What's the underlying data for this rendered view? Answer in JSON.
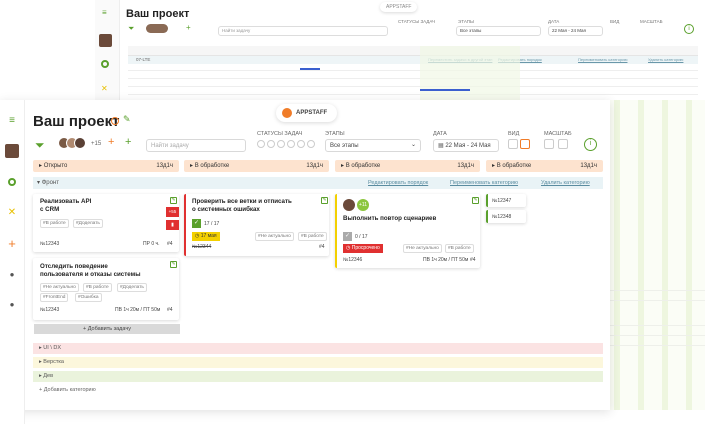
{
  "background": {
    "title": "Ваш проект",
    "brand": "APPSTAFF",
    "search_placeholder": "Найти задачу",
    "status_label": "СТАТУСЫ ЗАДАЧ",
    "stages_label": "ЭТАПЫ",
    "stages_value": "Все этапы",
    "date_label": "ДАТА",
    "date_value": "22 Мая - 24 Мая",
    "view_label": "ВИД",
    "scale_label": "МАСШТАБ",
    "rows_label": "07-LTE",
    "links": [
      "Переместить задачи в другой этап",
      "Редактировать порядок",
      "Переименовать категорию",
      "Удалить категорию"
    ]
  },
  "header": {
    "title": "Ваш проект",
    "brand": "APPSTAFF",
    "avatar_count": "+15",
    "search_placeholder": "Найти задачу",
    "status_label": "СТАТУСЫ ЗАДАЧ",
    "stages_label": "ЭТАПЫ",
    "stages_value": "Все этапы",
    "date_label": "ДАТА",
    "date_value": "22 Мая - 24 Мая",
    "view_label": "ВИД",
    "scale_label": "МАСШТАБ"
  },
  "columns": [
    {
      "label": "Открыто",
      "count": "13д1ч",
      "color": "#fde3cf"
    },
    {
      "label": "В обработке",
      "count": "13д1ч",
      "color": "#fde3cf"
    },
    {
      "label": "В обработке",
      "count": "13д1ч",
      "color": "#fde3cf"
    },
    {
      "label": "В обработке",
      "count": "13д1ч",
      "color": "#fde3cf"
    }
  ],
  "category": {
    "name": "Фронт",
    "links": [
      "Редактировать порядок",
      "Переименовать категорию",
      "Удалить категорию"
    ]
  },
  "cards": {
    "c1": {
      "title": "Реализовать API\nс CRM",
      "tags": [
        "#В работе",
        "#Доделать"
      ],
      "id": "№12343",
      "est": "ПР 0 ч.",
      "num": "#4",
      "badge": "+55"
    },
    "c2": {
      "title": "Отследить поведение\nпользователя и отказы системы",
      "tags": [
        "#Не актуально",
        "#В работе",
        "#Доделать",
        "#FrontEnd",
        "#Ошибка"
      ],
      "id": "№12343",
      "est": "ПВ 1ч 20м / ПТ 50м",
      "num": "#4"
    },
    "c3": {
      "title": "Проверить все ветки и отписать\nо системных ошибках",
      "progress": "17 / 17",
      "deadline": "17 мая",
      "tags": [
        "#Не актуально",
        "#В работе"
      ],
      "id": "№12344",
      "num": "#4"
    },
    "c4": {
      "title": "Выполнить повтор сценариев",
      "avatar_badge": "+11",
      "progress": "0 / 17",
      "overdue": "Просрочено",
      "tags": [
        "#Не актуально",
        "#В работе"
      ],
      "id": "№12346",
      "est": "ПВ 1ч 20м / ПТ 50м",
      "num": "#4"
    },
    "c5": {
      "id": "№12347"
    },
    "c6": {
      "id": "№12348"
    }
  },
  "add_task_label": "+ Добавить задачу",
  "groups": [
    {
      "label": "UI \\ DX",
      "color": "#fbe3e3"
    },
    {
      "label": "Верстка",
      "color": "#fcf7dc"
    },
    {
      "label": "Дев",
      "color": "#eaf3dc"
    }
  ],
  "add_category_label": "+ Добавить категорию",
  "accent": "#f07c28"
}
